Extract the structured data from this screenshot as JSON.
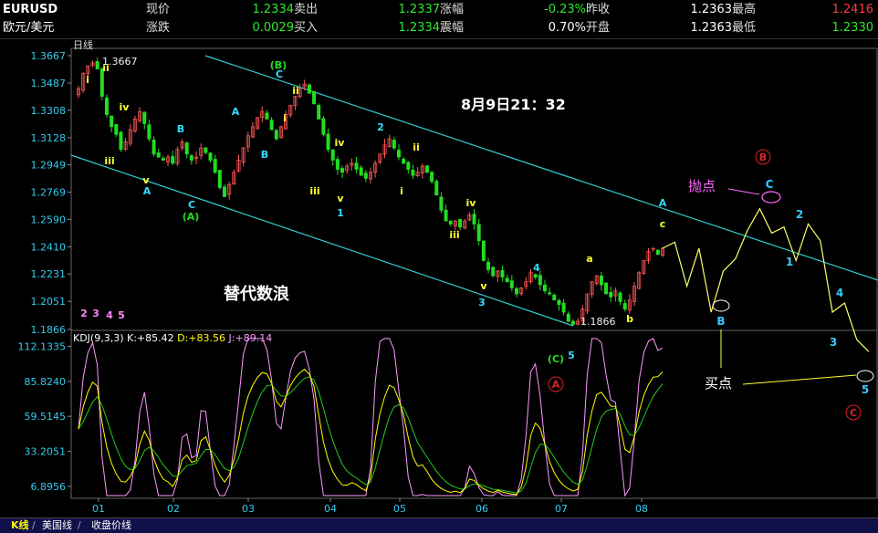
{
  "quote": {
    "row1": {
      "symbol": "EURUSD",
      "l1": "现价",
      "v1": "1.2334",
      "l2": "卖出",
      "v2": "1.2337",
      "l3": "涨幅",
      "v3": "-0.23%",
      "l4": "昨收",
      "v4": "1.2363",
      "l5": "最高",
      "v5": "1.2416"
    },
    "row2": {
      "symbol": "欧元/美元",
      "l1": "涨跌",
      "v1": "0.0029",
      "l2": "买入",
      "v2": "1.2334",
      "l3": "震幅",
      "v3": "0.70%",
      "l4": "开盘",
      "v4": "1.2363",
      "l5": "最低",
      "v5": "1.2330"
    }
  },
  "tabs": [
    "K线",
    "美国线",
    "收盘价线"
  ],
  "colors": {
    "up": "#ff5555",
    "down": "#22dd22",
    "channel": "#33cccc",
    "wave_yellow": "#ffff33",
    "wave_cyan": "#33ddff",
    "wave_green": "#22dd22",
    "wave_pink": "#ff88ff",
    "circle_red": "#dd2222",
    "k_line": "#ffffff",
    "d_line": "#ffff00",
    "j_line": "#ff99ff"
  },
  "chart_data": [
    {
      "type": "candlestick",
      "period_label": "日线",
      "y_ticks": [
        "1.3667",
        "1.3487",
        "1.3308",
        "1.3128",
        "1.2949",
        "1.2769",
        "1.2590",
        "1.2410",
        "1.2231",
        "1.2051",
        "1.1866"
      ],
      "ylim": [
        1.1866,
        1.3667
      ],
      "x_ticks": [
        "01",
        "02",
        "03",
        "04",
        "05",
        "06",
        "07",
        "08"
      ],
      "high_label": "1.3667",
      "low_label": "1.1866",
      "annotation_time": "8月9日21：32",
      "annotation_title": "替代数浪",
      "sell_label": "抛点",
      "buy_label": "买点",
      "wave_labels": {
        "yellow": [
          "i",
          "ii",
          "iii",
          "iv",
          "v",
          "i",
          "ii",
          "iii",
          "iv",
          "v",
          "i",
          "ii",
          "iii",
          "iv",
          "v",
          "a",
          "b",
          "c",
          "ii",
          "i"
        ],
        "cyan": [
          "A",
          "B",
          "C",
          "A",
          "B",
          "C",
          "1",
          "2",
          "3",
          "4",
          "5",
          "A",
          "B",
          "C",
          "1",
          "2",
          "3",
          "4",
          "5"
        ],
        "green": [
          "(A)",
          "(B)",
          "(C)"
        ],
        "pink": [
          "2",
          "3",
          "4",
          "5"
        ],
        "circled": [
          "A",
          "B",
          "C"
        ]
      },
      "closes": [
        1.345,
        1.355,
        1.36,
        1.362,
        1.358,
        1.34,
        1.328,
        1.32,
        1.315,
        1.305,
        1.31,
        1.318,
        1.325,
        1.33,
        1.322,
        1.312,
        1.302,
        1.3,
        1.298,
        1.3,
        1.296,
        1.305,
        1.31,
        1.302,
        1.298,
        1.3,
        1.306,
        1.303,
        1.298,
        1.29,
        1.28,
        1.274,
        1.282,
        1.29,
        1.298,
        1.306,
        1.314,
        1.32,
        1.326,
        1.33,
        1.325,
        1.318,
        1.312,
        1.32,
        1.328,
        1.334,
        1.34,
        1.345,
        1.348,
        1.342,
        1.335,
        1.325,
        1.315,
        1.305,
        1.298,
        1.292,
        1.29,
        1.294,
        1.296,
        1.292,
        1.288,
        1.286,
        1.29,
        1.296,
        1.302,
        1.308,
        1.312,
        1.306,
        1.3,
        1.296,
        1.292,
        1.288,
        1.29,
        1.294,
        1.29,
        1.284,
        1.275,
        1.265,
        1.258,
        1.256,
        1.258,
        1.254,
        1.258,
        1.262,
        1.256,
        1.245,
        1.232,
        1.226,
        1.222,
        1.225,
        1.221,
        1.218,
        1.214,
        1.21,
        1.214,
        1.218,
        1.224,
        1.221,
        1.216,
        1.212,
        1.21,
        1.206,
        1.203,
        1.198,
        1.192,
        1.19,
        1.192,
        1.2,
        1.21,
        1.218,
        1.222,
        1.216,
        1.21,
        1.208,
        1.212,
        1.205,
        1.2,
        1.206,
        1.215,
        1.224,
        1.232,
        1.238,
        1.24,
        1.236,
        1.24
      ],
      "projection_path": [
        1.24,
        1.244,
        1.215,
        1.24,
        1.198,
        1.225,
        1.233,
        1.252,
        1.266,
        1.25,
        1.254,
        1.232,
        1.256,
        1.245,
        1.198,
        1.204,
        1.18,
        1.172
      ],
      "series": [
        {
          "name": "",
          "values": []
        }
      ]
    },
    {
      "type": "line",
      "indicator_label": "KDJ(9,3,3)",
      "k_label": "K:",
      "k_value": "+85.42",
      "d_label": "D:",
      "d_value": "+83.56",
      "j_label": "J:",
      "j_value": "+89.14",
      "y_ticks": [
        "112.1335",
        "85.8240",
        "59.5145",
        "33.2051",
        "6.8956"
      ],
      "ylim": [
        0,
        120
      ],
      "x_ticks": [
        "01",
        "02",
        "03",
        "04",
        "05",
        "06",
        "07",
        "08"
      ]
    }
  ]
}
